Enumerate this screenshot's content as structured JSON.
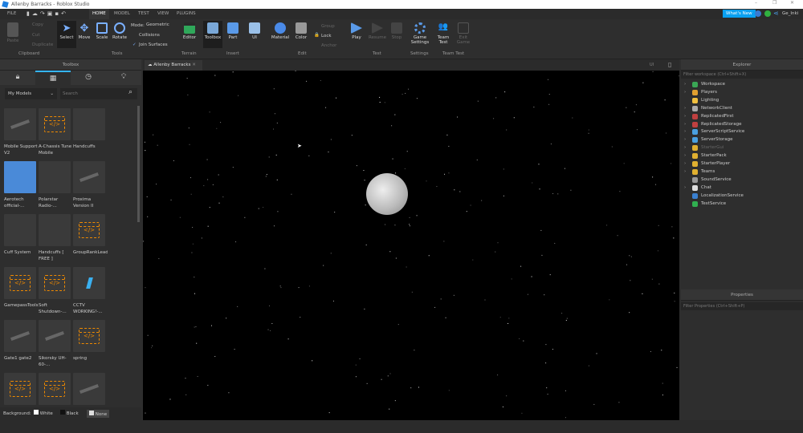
{
  "window": {
    "title": "Allenby Barracks - Roblox Studio"
  },
  "menu": {
    "file": "FILE",
    "tabs": [
      "HOME",
      "MODEL",
      "TEST",
      "VIEW",
      "PLUGINS"
    ],
    "whats_new": "What's New",
    "user": "Ge_Inki"
  },
  "ribbon": {
    "clipboard": {
      "paste": "Paste",
      "copy": "Copy",
      "cut": "Cut",
      "duplicate": "Duplicate",
      "label": "Clipboard"
    },
    "tools": {
      "select": "Select",
      "move": "Move",
      "scale": "Scale",
      "rotate": "Rotate",
      "mode_label": "Mode:",
      "mode_value": "Geometric",
      "collisions": "Collisions",
      "join_surfaces": "Join Surfaces",
      "label": "Tools"
    },
    "terrain": {
      "editor": "Editor",
      "label": "Terrain"
    },
    "insert": {
      "toolbox": "Toolbox",
      "part": "Part",
      "ui": "UI",
      "label": "Insert"
    },
    "edit": {
      "material": "Material",
      "color": "Color",
      "group": "Group",
      "lock": "Lock",
      "anchor": "Anchor",
      "label": "Edit"
    },
    "test": {
      "play": "Play",
      "resume": "Resume",
      "stop": "Stop",
      "label": "Test"
    },
    "settings": {
      "game_settings": "Game Settings",
      "label": "Settings"
    },
    "team_test": {
      "team_test": "Team Test",
      "exit_game": "Exit Game",
      "label": "Team Test"
    }
  },
  "toolbox": {
    "title": "Toolbox",
    "category": "My Models",
    "search_placeholder": "Search",
    "items": [
      {
        "name": "Mobile Support V2",
        "type": "model"
      },
      {
        "name": "A-Chassis Tune Mobile",
        "type": "script"
      },
      {
        "name": "Handcuffs",
        "type": "empty"
      },
      {
        "name": "Aerotech official-...",
        "type": "aero"
      },
      {
        "name": "Polarstar Radio-...",
        "type": "empty"
      },
      {
        "name": "Proxima Version II",
        "type": "model"
      },
      {
        "name": "Cuff System",
        "type": "empty"
      },
      {
        "name": "Handcuffs [ FREE ]",
        "type": "empty"
      },
      {
        "name": "GroupRankLeaderboard",
        "type": "script"
      },
      {
        "name": "GamepassTools",
        "type": "script"
      },
      {
        "name": "Soft Shutdown-...",
        "type": "script"
      },
      {
        "name": "CCTV WORKING!-...",
        "type": "cctv"
      },
      {
        "name": "Gate1 gate2",
        "type": "model"
      },
      {
        "name": "Sikorsky UH-60-...",
        "type": "model"
      },
      {
        "name": "spring",
        "type": "script"
      },
      {
        "name": "",
        "type": "script"
      },
      {
        "name": "",
        "type": "script"
      },
      {
        "name": "",
        "type": "model"
      }
    ],
    "background_label": "Background:",
    "bg_options": [
      "White",
      "Black",
      "None"
    ]
  },
  "viewport": {
    "tab": "Allenby Barracks",
    "ui_toggle": "UI"
  },
  "explorer": {
    "title": "Explorer",
    "filter_placeholder": "Filter workspace (Ctrl+Shift+X)",
    "items": [
      {
        "name": "Workspace",
        "expand": true,
        "color": "#3aa655"
      },
      {
        "name": "Players",
        "expand": true,
        "color": "#e0a030"
      },
      {
        "name": "Lighting",
        "expand": false,
        "color": "#f0c040"
      },
      {
        "name": "NetworkClient",
        "expand": true,
        "color": "#aaaaaa"
      },
      {
        "name": "ReplicatedFirst",
        "expand": true,
        "color": "#c04040"
      },
      {
        "name": "ReplicatedStorage",
        "expand": true,
        "color": "#c04040"
      },
      {
        "name": "ServerScriptService",
        "expand": true,
        "color": "#4aa0e0"
      },
      {
        "name": "ServerStorage",
        "expand": true,
        "color": "#4aa0e0"
      },
      {
        "name": "StarterGui",
        "expand": true,
        "color": "#e0b030",
        "dim": true
      },
      {
        "name": "StarterPack",
        "expand": true,
        "color": "#e0b030"
      },
      {
        "name": "StarterPlayer",
        "expand": true,
        "color": "#e0b030"
      },
      {
        "name": "Teams",
        "expand": true,
        "color": "#e0b030"
      },
      {
        "name": "SoundService",
        "expand": false,
        "color": "#999999"
      },
      {
        "name": "Chat",
        "expand": true,
        "color": "#dddddd"
      },
      {
        "name": "LocalizationService",
        "expand": false,
        "color": "#3a80d0"
      },
      {
        "name": "TestService",
        "expand": false,
        "color": "#30b050"
      }
    ]
  },
  "properties": {
    "title": "Properties",
    "filter_placeholder": "Filter Properties (Ctrl+Shift+P)"
  },
  "colors": {
    "accent": "#35b5ff",
    "script_orange": "#f08a00",
    "viewport": "#000000"
  }
}
